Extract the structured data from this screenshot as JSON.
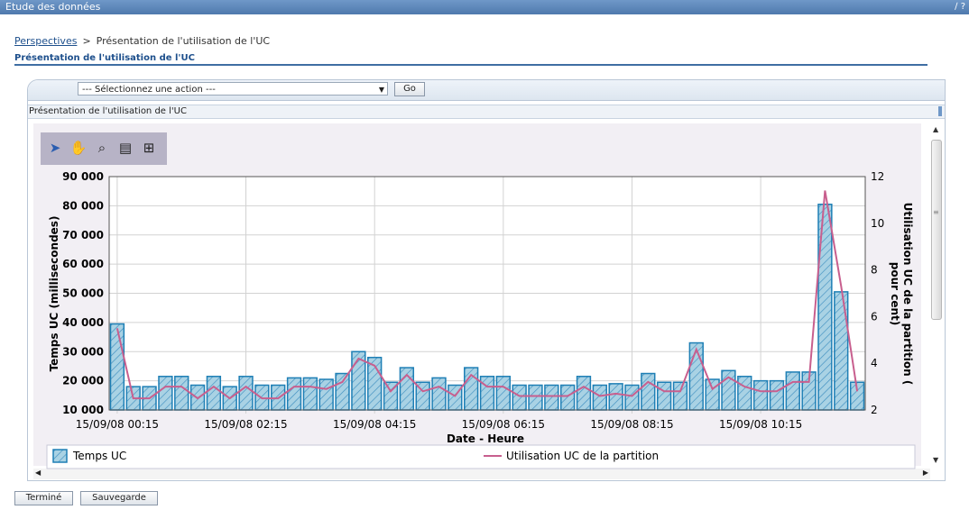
{
  "window": {
    "title": "Etude des données",
    "icons": "∕ ?"
  },
  "breadcrumb": {
    "link": "Perspectives",
    "separator": ">",
    "current": "Présentation de l'utilisation de l'UC"
  },
  "page_title": "Présentation de l'utilisation de l'UC",
  "action_bar": {
    "select_value": "--- Sélectionnez une action ---",
    "go_label": "Go"
  },
  "section_title": "Présentation de l'utilisation de l'UC",
  "tools": [
    "select-tool",
    "pan-tool",
    "zoom-tool",
    "annotate-tool",
    "crosshair-tool"
  ],
  "buttons": {
    "done": "Terminé",
    "save": "Sauvegarde"
  },
  "chart_data": {
    "type": "bar",
    "xlabel": "Date - Heure",
    "ylabel": "Temps UC (millisecondes)",
    "y2label": "Utilisation UC de la partition (pour cent)",
    "ylim": [
      10000,
      90000
    ],
    "y2lim": [
      2,
      12
    ],
    "yticks": [
      "10 000",
      "20 000",
      "30 000",
      "40 000",
      "50 000",
      "60 000",
      "70 000",
      "80 000",
      "90 000"
    ],
    "y2ticks": [
      "2",
      "4",
      "6",
      "8",
      "10",
      "12"
    ],
    "xtick_labels": [
      "15/09/08 00:15",
      "15/09/08 02:15",
      "15/09/08 04:15",
      "15/09/08 06:15",
      "15/09/08 08:15",
      "15/09/08 10:15"
    ],
    "grid": true,
    "legend_position": "bottom",
    "colors": {
      "bar_fill": "#a9d2e4",
      "bar_stroke": "#1e7fb5",
      "line": "#c85f8e",
      "plot_bg": "#ffffff",
      "frame_bg": "#f2eff4"
    },
    "series": [
      {
        "name": "Temps UC",
        "type": "bar",
        "axis": "left",
        "values": [
          39500,
          18000,
          18000,
          21500,
          21500,
          18500,
          21500,
          18000,
          21500,
          18500,
          18500,
          21000,
          21000,
          20500,
          22500,
          30000,
          28000,
          19500,
          24500,
          19500,
          21000,
          18500,
          24500,
          21500,
          21500,
          18500,
          18500,
          18500,
          18500,
          21500,
          18500,
          19000,
          18500,
          22500,
          19500,
          19500,
          33000,
          20500,
          23500,
          21500,
          20000,
          20000,
          23000,
          23000,
          80500,
          50500,
          19500
        ]
      },
      {
        "name": "Utilisation UC de la partition",
        "type": "line",
        "axis": "right",
        "values": [
          5.5,
          2.5,
          2.5,
          3.0,
          3.0,
          2.5,
          3.0,
          2.5,
          3.0,
          2.5,
          2.5,
          3.0,
          3.0,
          2.9,
          3.2,
          4.2,
          3.9,
          2.8,
          3.5,
          2.8,
          3.0,
          2.6,
          3.5,
          3.0,
          3.0,
          2.6,
          2.6,
          2.6,
          2.6,
          3.0,
          2.6,
          2.7,
          2.6,
          3.2,
          2.8,
          2.8,
          4.6,
          2.9,
          3.4,
          3.0,
          2.8,
          2.8,
          3.2,
          3.2,
          11.4,
          7.3,
          2.8
        ]
      }
    ]
  }
}
